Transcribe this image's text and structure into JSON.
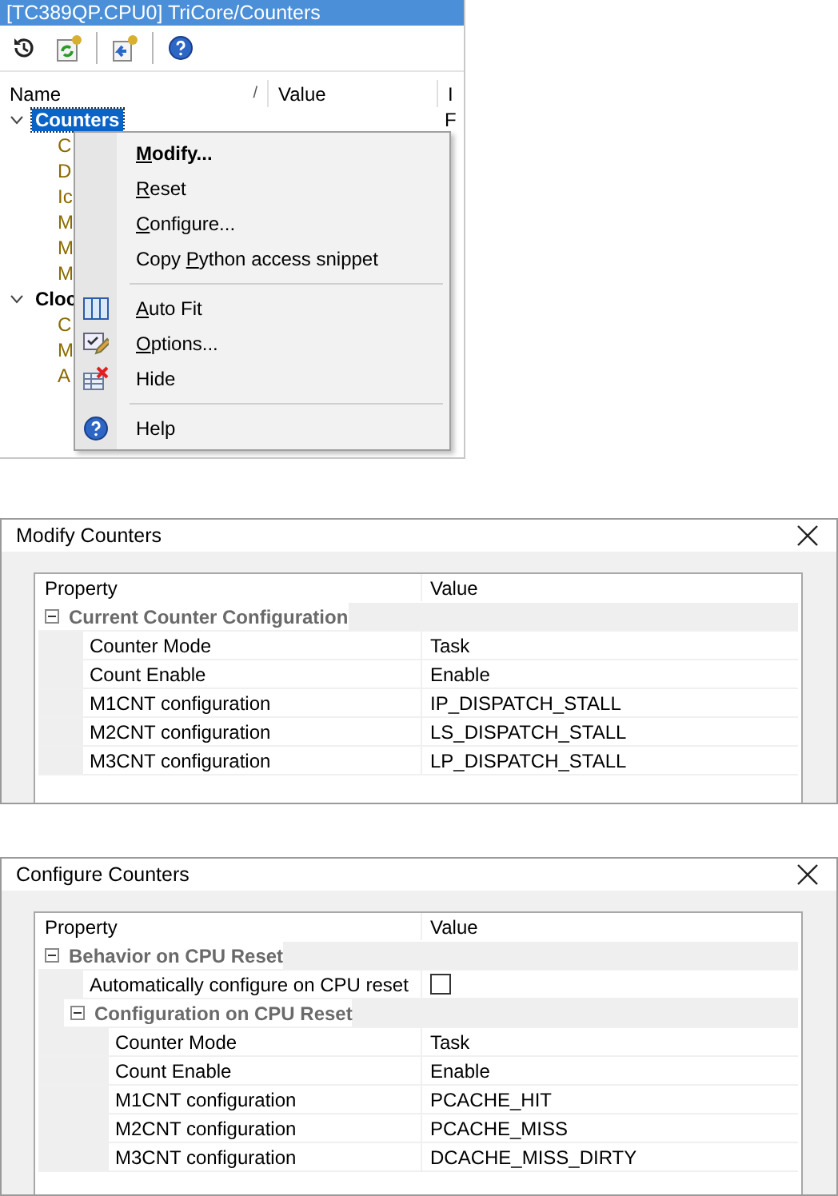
{
  "window": {
    "title": "[TC389QP.CPU0] TriCore/Counters"
  },
  "toolbar": [
    {
      "kind": "history"
    },
    {
      "kind": "refresh"
    },
    {
      "kind": "import"
    },
    {
      "kind": "help"
    }
  ],
  "tree": {
    "columns": [
      "Name",
      "Value",
      "I"
    ],
    "sort_mark": "/",
    "items": [
      {
        "name": "Counters",
        "column_3": "F",
        "selected": true,
        "expanded": true,
        "children": [
          {
            "name": "C"
          },
          {
            "name": "D"
          },
          {
            "name": "Ic"
          },
          {
            "name": "M"
          },
          {
            "name": "M"
          },
          {
            "name": "M"
          }
        ]
      },
      {
        "name": "Cloc",
        "selected": false,
        "expanded": true,
        "children": [
          {
            "name": "C"
          },
          {
            "name": "M"
          },
          {
            "name": "A"
          }
        ]
      }
    ]
  },
  "context_menu": {
    "items": [
      {
        "kind": "plain",
        "key": "M",
        "rest": "odify...",
        "default": true
      },
      {
        "kind": "plain",
        "key": "R",
        "rest": "eset",
        "default": false
      },
      {
        "kind": "plain",
        "key": "C",
        "rest": "onfigure...",
        "default": false
      },
      {
        "kind": "plain",
        "lead": "Copy ",
        "key": "P",
        "rest": "ython access snippet",
        "default": false
      },
      {
        "kind": "separator"
      },
      {
        "kind": "autofit",
        "key": "A",
        "rest": "uto Fit",
        "default": false
      },
      {
        "kind": "options",
        "key": "O",
        "rest": "ptions...",
        "default": false
      },
      {
        "kind": "hide",
        "rest": "Hide",
        "default": false
      },
      {
        "kind": "separator"
      },
      {
        "kind": "help",
        "rest": "Help",
        "default": false
      }
    ]
  },
  "dialogs": [
    {
      "title": "Modify Counters",
      "columns": [
        "Property",
        "Value"
      ],
      "rows": [
        {
          "kind": "group",
          "name": "Current Counter Configuration",
          "expanded": true,
          "children": [
            {
              "kind": "property",
              "name": "Counter Mode",
              "value": "Task"
            },
            {
              "kind": "property",
              "name": "Count Enable",
              "value": "Enable"
            },
            {
              "kind": "property",
              "name": "M1CNT configuration",
              "value": "IP_DISPATCH_STALL"
            },
            {
              "kind": "property",
              "name": "M2CNT configuration",
              "value": "LS_DISPATCH_STALL"
            },
            {
              "kind": "property",
              "name": "M3CNT configuration",
              "value": "LP_DISPATCH_STALL"
            }
          ]
        }
      ]
    },
    {
      "title": "Configure Counters",
      "columns": [
        "Property",
        "Value"
      ],
      "rows": [
        {
          "kind": "group",
          "name": "Behavior on CPU Reset",
          "expanded": true,
          "children": [
            {
              "kind": "checkbox",
              "name": "Automatically configure on CPU reset",
              "checked": false
            },
            {
              "kind": "group",
              "name": "Configuration on CPU Reset",
              "expanded": true,
              "children": [
                {
                  "kind": "property",
                  "name": "Counter Mode",
                  "value": "Task"
                },
                {
                  "kind": "property",
                  "name": "Count Enable",
                  "value": "Enable"
                },
                {
                  "kind": "property",
                  "name": "M1CNT configuration",
                  "value": "PCACHE_HIT"
                },
                {
                  "kind": "property",
                  "name": "M2CNT configuration",
                  "value": "PCACHE_MISS"
                },
                {
                  "kind": "property",
                  "name": "M3CNT configuration",
                  "value": "DCACHE_MISS_DIRTY"
                }
              ]
            }
          ]
        }
      ]
    }
  ]
}
